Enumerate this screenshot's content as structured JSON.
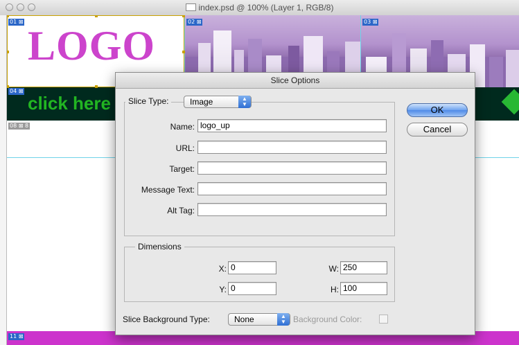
{
  "window": {
    "title": "index.psd @ 100% (Layer 1, RGB/8)"
  },
  "canvas": {
    "logo_text": "LOGO",
    "nav_text": "click here",
    "slice_tags": {
      "s01": "01 ⊠",
      "s02": "02 ⊠",
      "s03": "03 ⊠",
      "s04": "04 ⊠",
      "s08": "08 ⊠ 8",
      "s11": "11 ⊠"
    }
  },
  "dialog": {
    "title": "Slice Options",
    "slice_type_label": "Slice Type:",
    "slice_type_value": "Image",
    "name_label": "Name:",
    "name_value": "logo_up",
    "url_label": "URL:",
    "url_value": "",
    "target_label": "Target:",
    "target_value": "",
    "message_label": "Message Text:",
    "message_value": "",
    "alt_label": "Alt Tag:",
    "alt_value": "",
    "dimensions_label": "Dimensions",
    "x_label": "X:",
    "x_value": "0",
    "y_label": "Y:",
    "y_value": "0",
    "w_label": "W:",
    "w_value": "250",
    "h_label": "H:",
    "h_value": "100",
    "bg_type_label": "Slice Background Type:",
    "bg_type_value": "None",
    "bg_color_label": "Background Color:",
    "ok_label": "OK",
    "cancel_label": "Cancel"
  }
}
